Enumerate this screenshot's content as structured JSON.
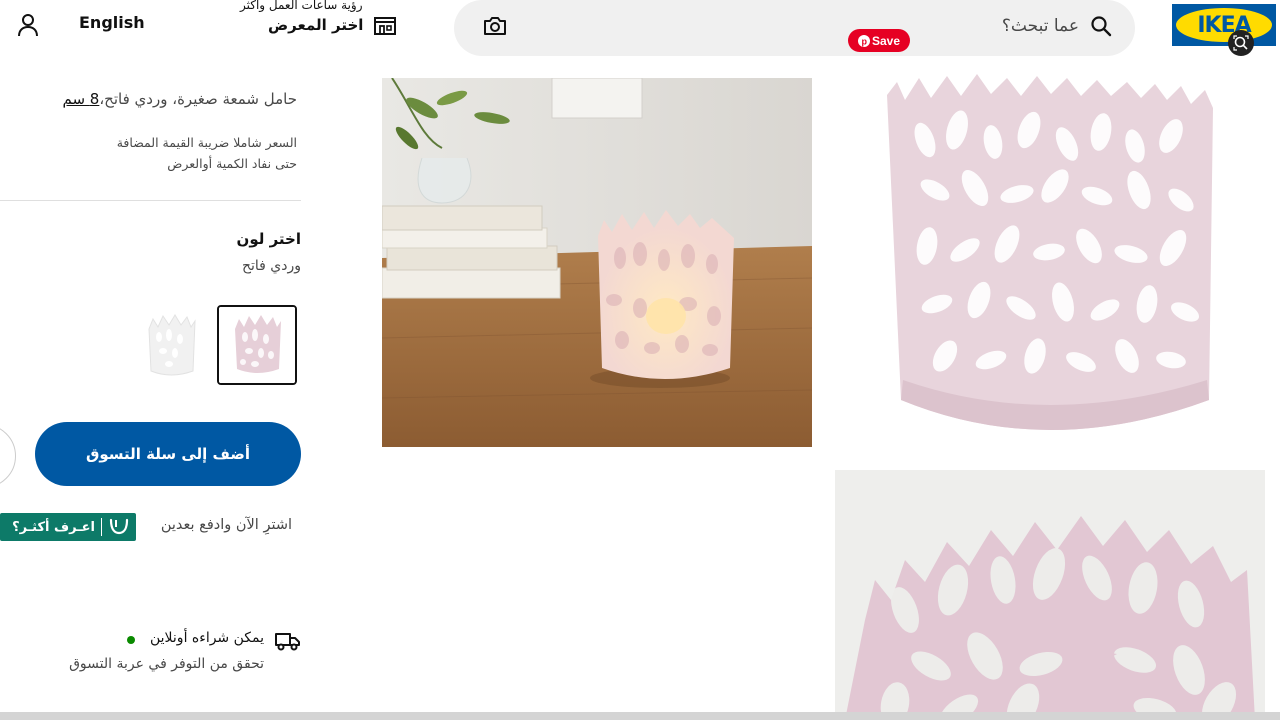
{
  "header": {
    "logo_text": "IKEA",
    "search_placeholder": "عما تبحث؟",
    "pinterest_save": "Save",
    "store_hours": "رؤية ساعات العمل واكثر",
    "store_select": "اختر المعرض",
    "language": "English",
    "icons": [
      "search-icon",
      "camera-icon",
      "store-icon",
      "user-icon",
      "lens-icon"
    ]
  },
  "product": {
    "description": "حامل شمعة صغيرة، وردي فاتح،",
    "size": "8 سم",
    "price_note_line1": "السعر شاملا ضريبة القيمة المضافة",
    "price_note_line2": "حتى نفاد الكمية أوالعرض",
    "color_title": "اختر لون",
    "color_value": "وردي فاتح",
    "swatches": [
      "وردي فاتح",
      "أبيض"
    ],
    "add_to_cart": "أضف إلى سلة التسوق",
    "bnpl_text": "اشترِ الآن وادفع بعدين",
    "tabby_label": "اعـرف أكثـر؟",
    "online_text": "يمكن شراءه أونلاين",
    "availability_text": "تحقق من التوفر في عربة التسوق"
  },
  "colors": {
    "brand_blue": "#0058a3",
    "brand_yellow": "#ffdb00",
    "pinterest_red": "#e60023",
    "tabby_green": "#0d7a68",
    "online_green": "#0a8a00",
    "product_pink": "#e8d4dc"
  }
}
